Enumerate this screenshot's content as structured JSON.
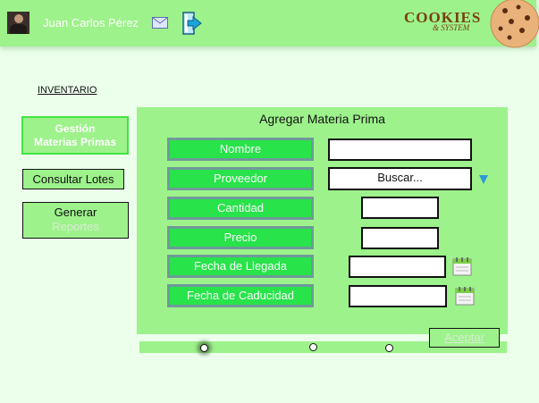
{
  "header": {
    "user_name": "Juan Carlos Pérez",
    "logo_line1": "COOKIES",
    "logo_line2": "& SYSTEM",
    "mail_icon": "mail-icon",
    "logout_icon": "logout-icon"
  },
  "nav": {
    "breadcrumb": "INVENTARIO"
  },
  "sidebar": {
    "gestion_line1": "Gestión",
    "gestion_line2": "Materias Primas",
    "lotes": "Consultar Lotes",
    "generar_line1": "Generar",
    "generar_line2": "Reportes"
  },
  "form": {
    "title": "Agregar Materia  Prima",
    "labels": {
      "nombre": "Nombre",
      "proveedor": "Proveedor",
      "cantidad": "Cantidad",
      "precio": "Precio",
      "fecha_llegada": "Fecha de Llegada",
      "fecha_caducidad": "Fecha de Caducidad"
    },
    "values": {
      "nombre": "",
      "proveedor": "Buscar...",
      "cantidad": "",
      "precio": "",
      "fecha_llegada": "",
      "fecha_caducidad": ""
    },
    "accept": "Aceptar"
  },
  "pagination": {
    "steps": 3,
    "current": 1
  },
  "colors": {
    "header_bg": "#9df28b",
    "page_bg": "#ebffeb",
    "label_bg": "#28e34a",
    "accent_blue": "#2f98d6"
  }
}
